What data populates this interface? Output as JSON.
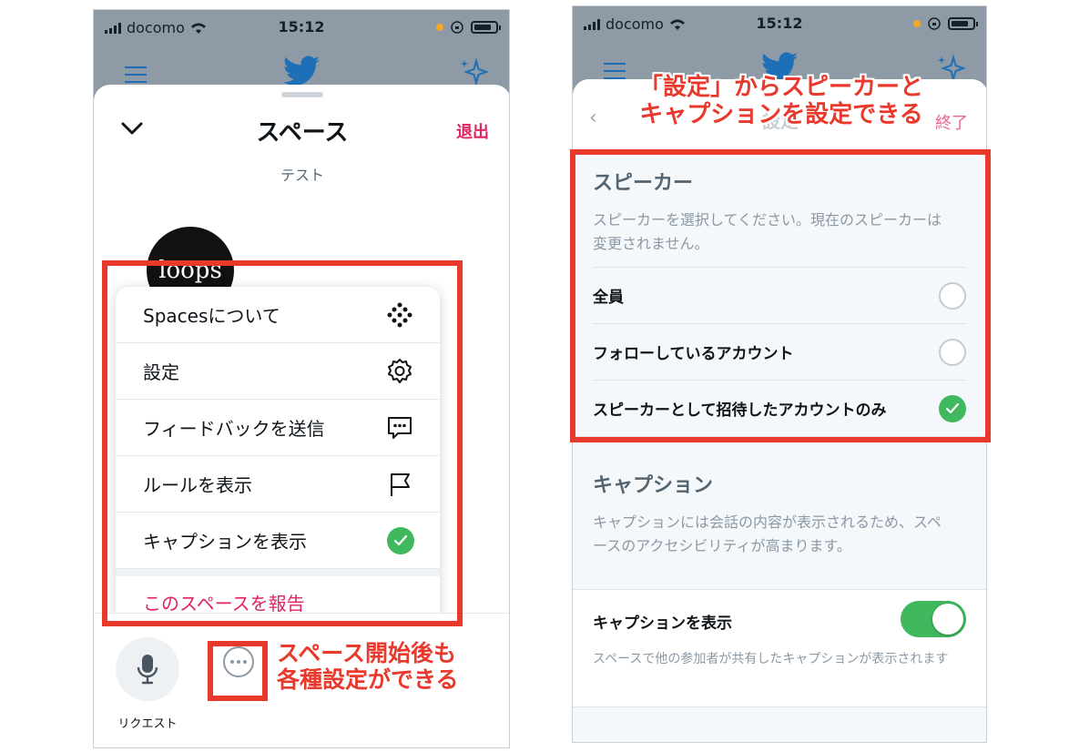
{
  "left_phone": {
    "status": {
      "carrier": "docomo",
      "time": "15:12"
    },
    "sheet": {
      "title": "スペース",
      "exit_label": "退出",
      "subtitle": "テスト",
      "avatar_text": "loops"
    },
    "menu": {
      "items": [
        {
          "label": "Spacesについて",
          "icon": "spaces-dots-icon"
        },
        {
          "label": "設定",
          "icon": "gear-icon"
        },
        {
          "label": "フィードバックを送信",
          "icon": "feedback-bubble-icon"
        },
        {
          "label": "ルールを表示",
          "icon": "flag-icon"
        },
        {
          "label": "キャプションを表示",
          "icon": "check-icon",
          "checked": true
        }
      ],
      "report_label": "このスペースを報告"
    },
    "bottom": {
      "request_label": "リクエスト"
    },
    "callout": {
      "line1": "スペース開始後も",
      "line2": "各種設定ができる"
    }
  },
  "right_phone": {
    "status": {
      "carrier": "docomo",
      "time": "15:12"
    },
    "header": {
      "title": "設定",
      "done_label": "終了"
    },
    "callout": {
      "line1": "「設定」からスピーカーと",
      "line2": "キャプションを設定できる"
    },
    "speaker": {
      "title": "スピーカー",
      "description": "スピーカーを選択してください。現在のスピーカーは変更されません。",
      "options": [
        {
          "label": "全員",
          "selected": false
        },
        {
          "label": "フォローしているアカウント",
          "selected": false
        },
        {
          "label": "スピーカーとして招待したアカウントのみ",
          "selected": true
        }
      ]
    },
    "caption": {
      "title": "キャプション",
      "description": "キャプションには会話の内容が表示されるため、スペースのアクセシビリティが高まります。",
      "toggle_label": "キャプションを表示",
      "toggle_on": true,
      "toggle_note": "スペースで他の参加者が共有したキャプションが表示されます"
    }
  },
  "colors": {
    "accent_red": "#e8392c",
    "twitter_blue": "#1d9bf0",
    "check_green": "#3fb85e",
    "danger_pink": "#e0245e"
  }
}
